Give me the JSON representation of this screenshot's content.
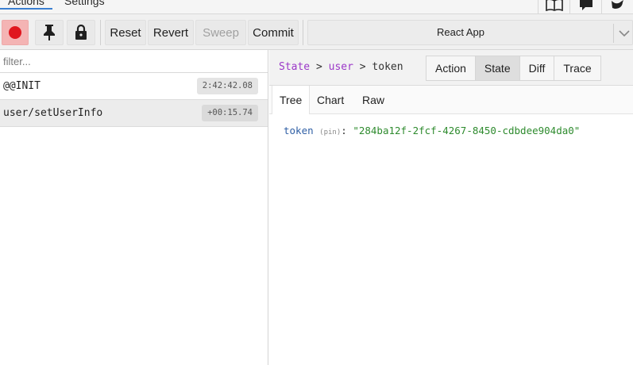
{
  "top_tabs": {
    "actions": "Actions",
    "settings": "Settings"
  },
  "toolbar": {
    "reset": "Reset",
    "revert": "Revert",
    "sweep": "Sweep",
    "commit": "Commit",
    "instance": "React App"
  },
  "filter": {
    "placeholder": "filter...",
    "value": ""
  },
  "actions": [
    {
      "name": "@@INIT",
      "time": "2:42:42.08"
    },
    {
      "name": "user/setUserInfo",
      "time": "+00:15.74"
    }
  ],
  "breadcrumb": {
    "root": "State",
    "sep": ">",
    "user": "user",
    "token": "token"
  },
  "view_tabs": [
    "Action",
    "State",
    "Diff",
    "Trace"
  ],
  "sub_tabs": [
    "Tree",
    "Chart",
    "Raw"
  ],
  "tree": {
    "key": "token",
    "pin": "(pin)",
    "value": "\"284ba12f-2fcf-4267-8450-cdbdee904da0\""
  },
  "colors": {
    "record": "#e0161e",
    "accent": "#3b7fd1",
    "key": "#2f5fa5",
    "string": "#2e8b2e",
    "path": "#9b38c8"
  }
}
